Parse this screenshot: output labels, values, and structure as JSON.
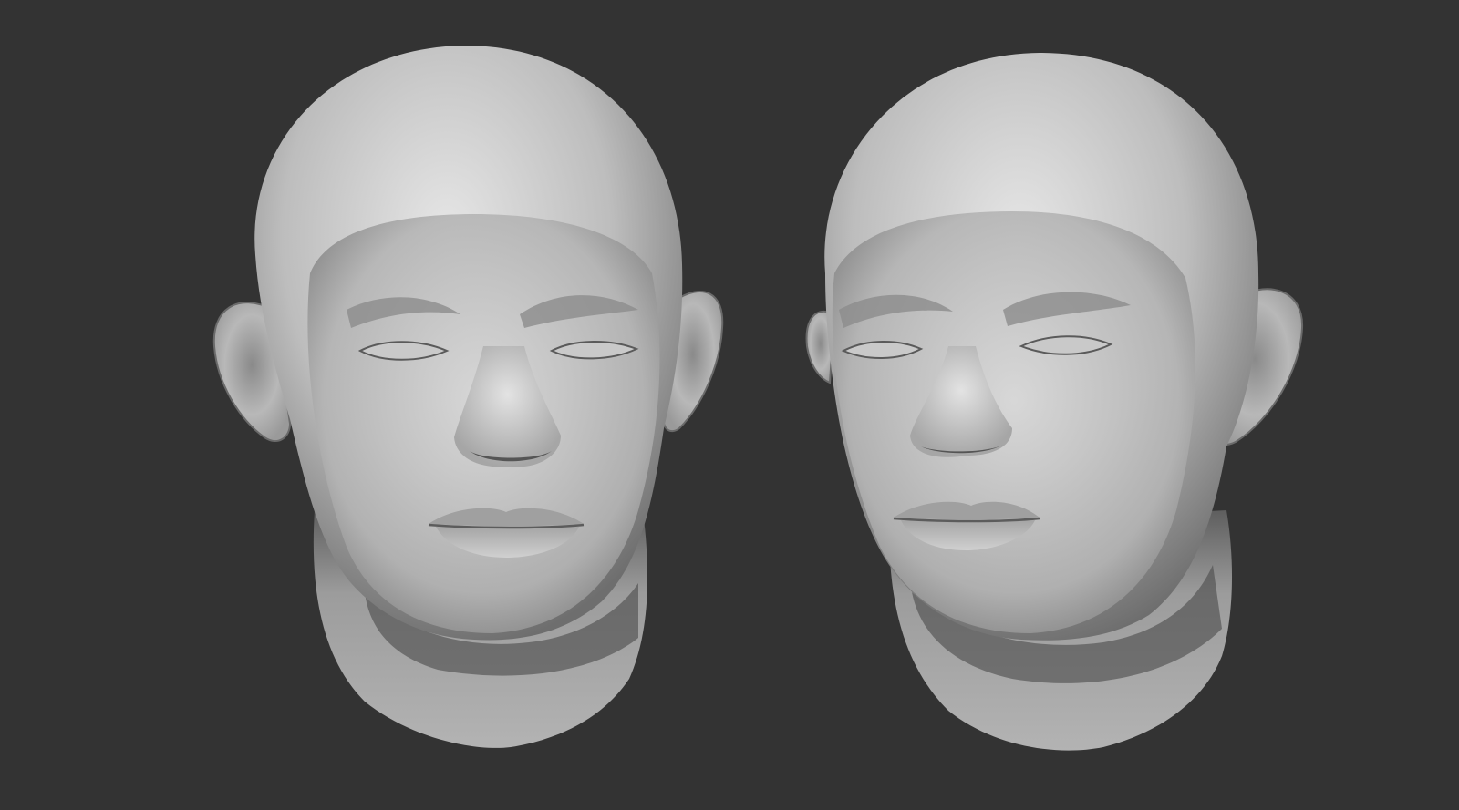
{
  "scene": {
    "background_color": "#333333",
    "material_color": "#bdbdbd",
    "models": [
      {
        "name": "sculpted-head-front",
        "view": "front"
      },
      {
        "name": "sculpted-head-turned",
        "view": "three-quarter-left"
      }
    ]
  }
}
